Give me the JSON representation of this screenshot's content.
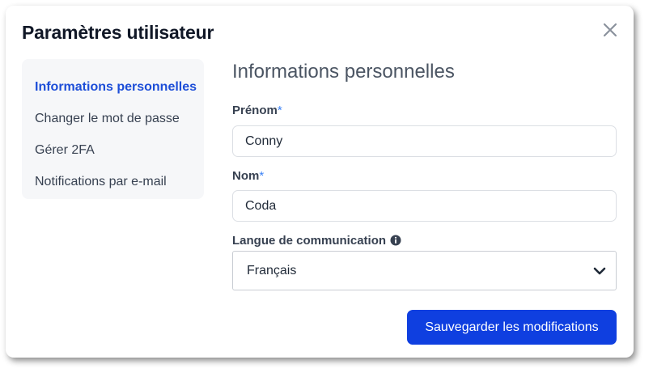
{
  "dialog": {
    "title": "Paramètres utilisateur"
  },
  "sidebar": {
    "items": [
      {
        "label": "Informations personnelles",
        "active": true
      },
      {
        "label": "Changer le mot de passe",
        "active": false
      },
      {
        "label": "Gérer 2FA",
        "active": false
      },
      {
        "label": "Notifications par e-mail",
        "active": false
      }
    ]
  },
  "form": {
    "section_title": "Informations personnelles",
    "first_name": {
      "label": "Prénom",
      "required_mark": "*",
      "value": "Conny"
    },
    "last_name": {
      "label": "Nom",
      "required_mark": "*",
      "value": "Coda"
    },
    "language": {
      "label": "Langue de communication",
      "selected": "Français",
      "info_icon": "info-circle-icon"
    },
    "save_label": "Sauvegarder les modifications"
  },
  "colors": {
    "accent": "#0f3fe0",
    "active_link": "#1d4ed8",
    "required": "#3b82f6",
    "sidebar_bg": "#f6f7f9"
  }
}
